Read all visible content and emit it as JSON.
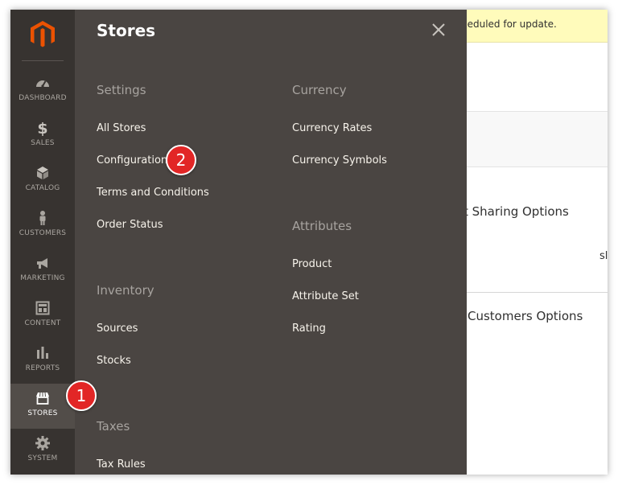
{
  "notice": {
    "text": "heduled for update."
  },
  "background_text": {
    "sharing": "t Sharing Options",
    "stub": "sl",
    "customers": "Customers Options"
  },
  "nav": {
    "items": [
      {
        "label": "DASHBOARD",
        "icon": "dashboard-icon"
      },
      {
        "label": "SALES",
        "icon": "dollar-icon",
        "glyph": "$"
      },
      {
        "label": "CATALOG",
        "icon": "cube-icon"
      },
      {
        "label": "CUSTOMERS",
        "icon": "person-icon"
      },
      {
        "label": "MARKETING",
        "icon": "megaphone-icon"
      },
      {
        "label": "CONTENT",
        "icon": "layout-icon"
      },
      {
        "label": "REPORTS",
        "icon": "bar-chart-icon"
      },
      {
        "label": "STORES",
        "icon": "storefront-icon",
        "active": true
      },
      {
        "label": "SYSTEM",
        "icon": "gear-icon"
      }
    ]
  },
  "panel": {
    "title": "Stores",
    "columns": {
      "left": [
        {
          "heading": "Settings",
          "links": [
            "All Stores",
            "Configuration",
            "Terms and Conditions",
            "Order Status"
          ]
        },
        {
          "heading": "Inventory",
          "links": [
            "Sources",
            "Stocks"
          ]
        },
        {
          "heading": "Taxes",
          "links": [
            "Tax Rules"
          ]
        }
      ],
      "right": [
        {
          "heading": "Currency",
          "links": [
            "Currency Rates",
            "Currency Symbols"
          ]
        },
        {
          "heading": "Attributes",
          "links": [
            "Product",
            "Attribute Set",
            "Rating"
          ]
        }
      ]
    }
  },
  "badges": {
    "one": "1",
    "two": "2"
  },
  "colors": {
    "nav_bg": "#373330",
    "panel_bg": "#4a4542",
    "logo": "#eb5202",
    "badge": "#e22626"
  }
}
